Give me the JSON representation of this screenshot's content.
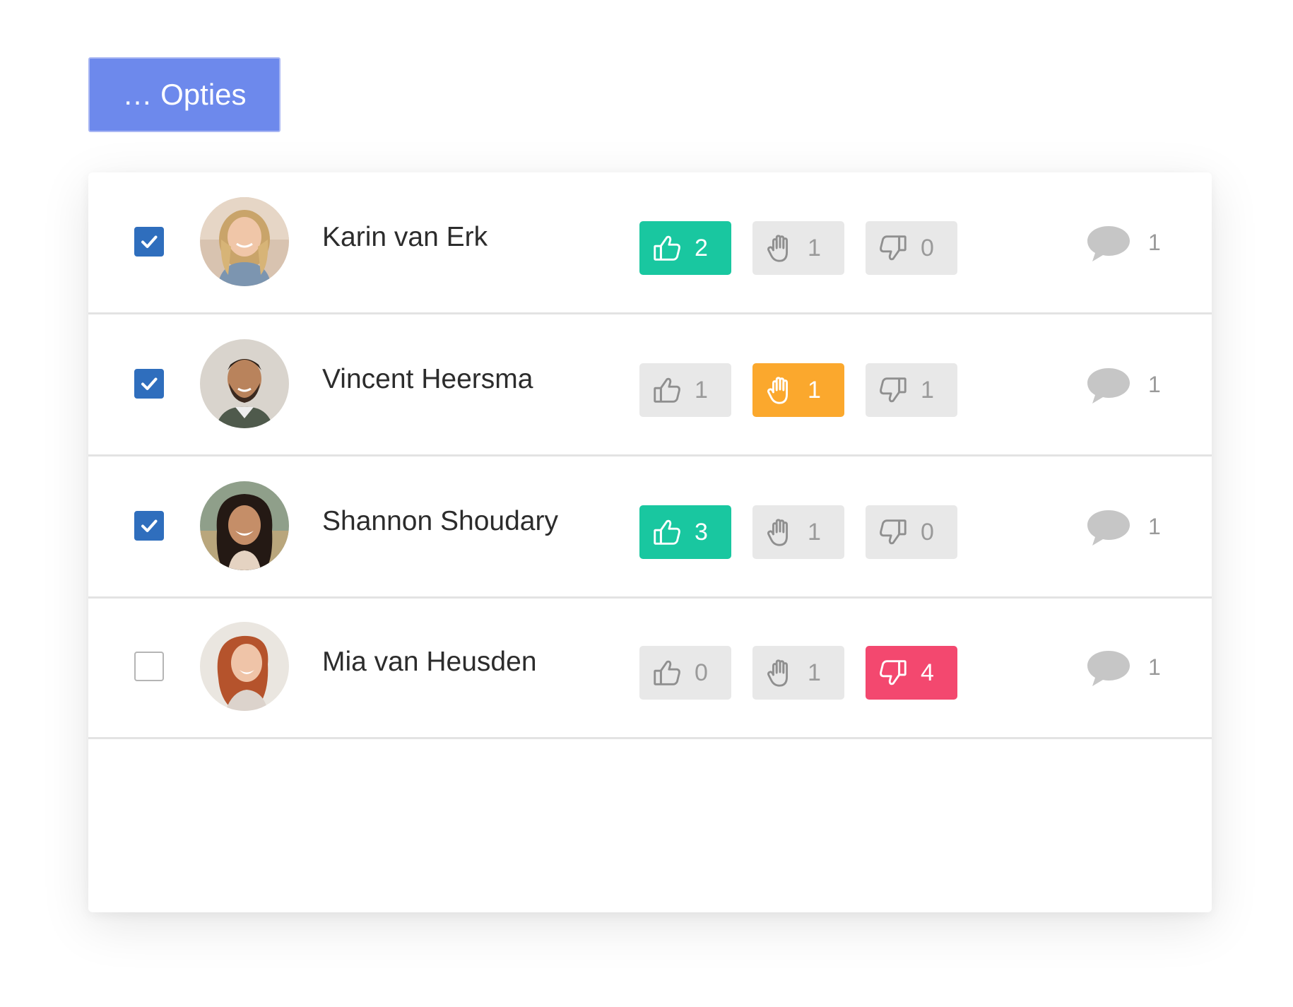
{
  "toolbar": {
    "options_label": "… Opties"
  },
  "colors": {
    "options_button": "#6d89ec",
    "checkbox_checked": "#2f6ebd",
    "thumbs_up_active": "#19c7a0",
    "hand_active": "#fba82d",
    "thumbs_down_active": "#f3486f",
    "inactive": "#e8e8e8"
  },
  "rows": [
    {
      "name": "Karin van Erk",
      "checked": true,
      "avatar": "avatar-photo",
      "thumbs_up": "2",
      "hand": "1",
      "thumbs_down": "0",
      "active_vote": "thumbs_up",
      "comments": "1"
    },
    {
      "name": "Vincent Heersma",
      "checked": true,
      "avatar": "avatar-photo",
      "thumbs_up": "1",
      "hand": "1",
      "thumbs_down": "1",
      "active_vote": "hand",
      "comments": "1"
    },
    {
      "name": "Shannon Shoudary",
      "checked": true,
      "avatar": "avatar-photo",
      "thumbs_up": "3",
      "hand": "1",
      "thumbs_down": "0",
      "active_vote": "thumbs_up",
      "comments": "1"
    },
    {
      "name": "Mia van Heusden",
      "checked": false,
      "avatar": "avatar-photo",
      "thumbs_up": "0",
      "hand": "1",
      "thumbs_down": "4",
      "active_vote": "thumbs_down",
      "comments": "1"
    }
  ]
}
